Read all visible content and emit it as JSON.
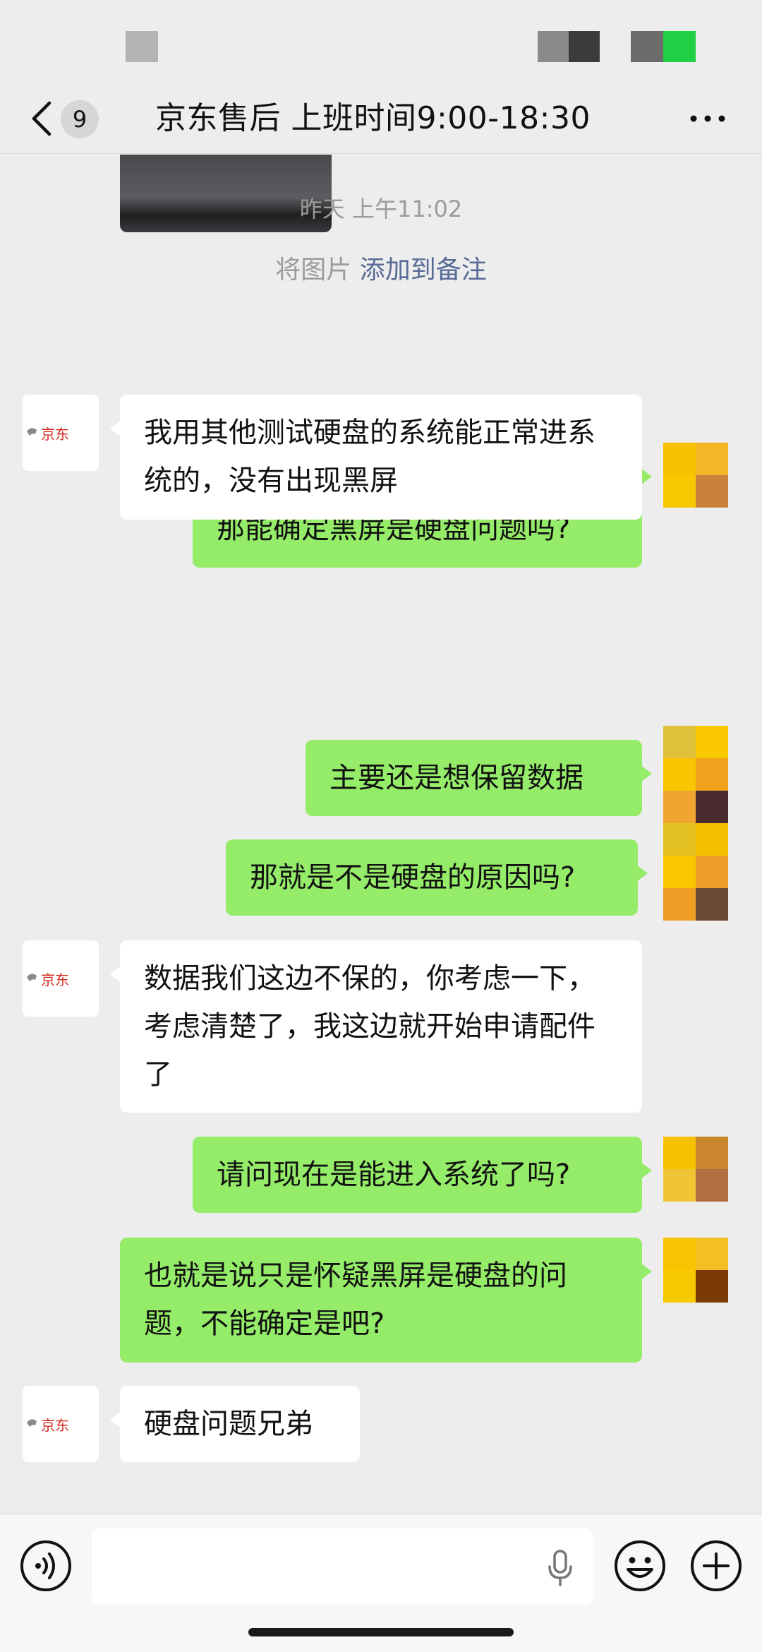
{
  "header": {
    "back_icon": "chevron-left-icon",
    "unread_count": "9",
    "title": "京东售后  上班时间9:00-18:30",
    "more_icon": "more-icon"
  },
  "chat": {
    "timestamp": "昨天 上午11:02",
    "system_notice": {
      "prefix": "将图片 ",
      "link": "添加到备注"
    },
    "messages": [
      {
        "side": "out",
        "text": "好的\n那能确定黑屏是硬盘问题吗?"
      },
      {
        "side": "in",
        "sender": "京东",
        "text": "我用其他测试硬盘的系统能正常进系统的，没有出现黑屏"
      },
      {
        "side": "out",
        "text": "主要还是想保留数据"
      },
      {
        "side": "out",
        "text": "那就是不是硬盘的原因吗?"
      },
      {
        "side": "in",
        "sender": "京东",
        "text": "数据我们这边不保的，你考虑一下，考虑清楚了，我这边就开始申请配件了"
      },
      {
        "side": "out",
        "text": "请问现在是能进入系统了吗?"
      },
      {
        "side": "out",
        "text": "也就是说只是怀疑黑屏是硬盘的问题，不能确定是吧?"
      },
      {
        "side": "in",
        "sender": "京东",
        "text": "硬盘问题兄弟"
      }
    ],
    "avatar_logo_text": "京东"
  },
  "input_bar": {
    "voice_icon": "voice-icon",
    "mic_icon": "microphone-icon",
    "emoji_icon": "emoji-icon",
    "plus_icon": "plus-icon"
  },
  "colors": {
    "outgoing_bubble": "#95ec69",
    "incoming_bubble": "#ffffff",
    "background": "#ededed",
    "link": "#576b95"
  }
}
